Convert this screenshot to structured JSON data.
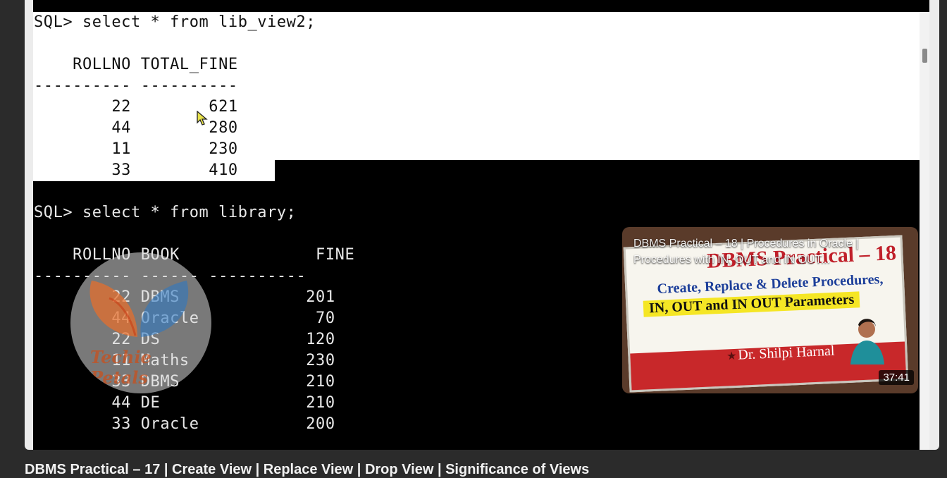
{
  "terminal": {
    "lines_top": [
      "SQL> select * from lib_view2;",
      "",
      "    ROLLNO TOTAL_FINE",
      "---------- ----------",
      "        22        621",
      "        44        280",
      "        11        230",
      "        33        410"
    ],
    "lines_bottom": [
      "",
      "SQL> select * from library;",
      "",
      "    ROLLNO BOOK              FINE",
      "---------- ------ ----------",
      "        22 DBMS             201",
      "        44 Oracle            70",
      "        22 DS               120",
      "        11 Maths            230",
      "        33 DBMS             210",
      "        44 DE               210",
      "        33 Oracle           200"
    ]
  },
  "watermark": {
    "text": "Techie Petals"
  },
  "end_card": {
    "title_line1": "DBMS Practical – 18 | Procedures in Oracle |",
    "title_line2": "Procedures with IN, OUT and IN OUT...",
    "thumb_heading": "DBMS Practical – 18",
    "thumb_line1": "Create, Replace & Delete Procedures,",
    "thumb_line2": "IN, OUT and IN OUT Parameters",
    "thumb_author": "Dr. Shilpi Harnal",
    "duration": "37:41"
  },
  "video_title_partial": "DBMS Practical – 17 | Create View | Replace View | Drop View | Significance of Views"
}
